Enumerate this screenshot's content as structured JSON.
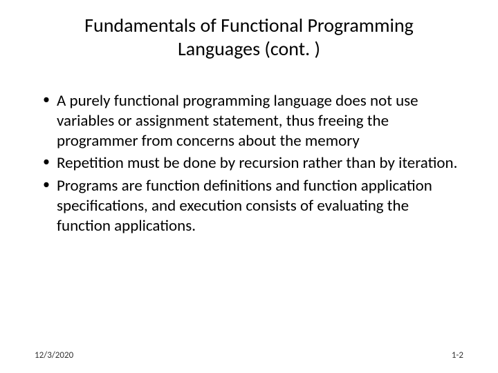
{
  "slide": {
    "title": "Fundamentals of Functional Programming Languages (cont. )",
    "bullets": [
      "A purely functional programming language does not use variables or assignment statement, thus freeing the programmer from concerns about the memory",
      "Repetition must be done by recursion rather than by iteration.",
      "Programs are function definitions and function application specifications, and execution consists of evaluating the function applications."
    ],
    "footer": {
      "date": "12/3/2020",
      "page": "1-2"
    }
  }
}
